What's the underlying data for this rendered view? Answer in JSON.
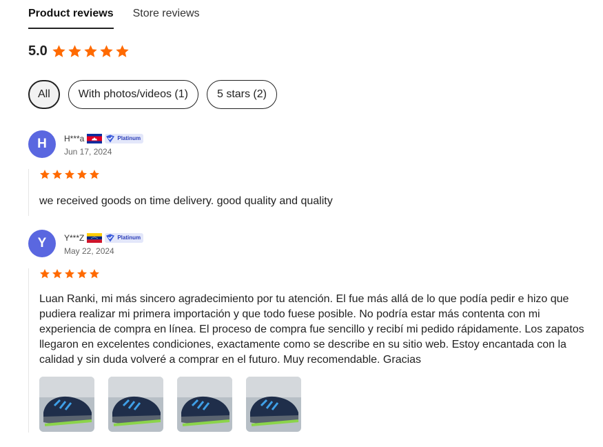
{
  "tabs": [
    {
      "label": "Product reviews",
      "active": true
    },
    {
      "label": "Store reviews",
      "active": false
    }
  ],
  "summary": {
    "score": "5.0",
    "stars": 5,
    "star_color": "#ff6a00"
  },
  "filters": [
    {
      "label": "All",
      "selected": true
    },
    {
      "label": "With photos/videos (1)",
      "selected": false
    },
    {
      "label": "5 stars (2)",
      "selected": false
    }
  ],
  "reviews": [
    {
      "initial": "H",
      "name": "H***a",
      "flag": "cambodia-flag-icon",
      "badge": "Platinum",
      "date": "Jun 17, 2024",
      "stars": 5,
      "text": "we received goods on time delivery. good quality and quality",
      "photos": []
    },
    {
      "initial": "Y",
      "name": "Y***Z",
      "flag": "venezuela-flag-icon",
      "badge": "Platinum",
      "date": "May 22, 2024",
      "stars": 5,
      "text": "Luan Ranki, mi más sincero agradecimiento por tu atención. El fue más allá de lo que podía pedir e hizo que pudiera realizar mi primera importación y que todo fuese posible. No podría estar más contenta con mi experiencia de compra en línea. El proceso de compra fue sencillo y recibí mi pedido rápidamente. Los zapatos llegaron en excelentes condiciones, exactamente como se describe en su sitio web. Estoy encantada con la calidad y sin duda volveré a comprar en el futuro. Muy recomendable. Gracias",
      "photos": [
        "sneaker-photo",
        "sneaker-photo",
        "sneaker-photo",
        "sneaker-photo"
      ]
    }
  ],
  "colors": {
    "accent": "#ff6a00",
    "avatar": "#5a67e0",
    "badge_bg": "#e3e7fa",
    "badge_text": "#2d3fb8"
  }
}
